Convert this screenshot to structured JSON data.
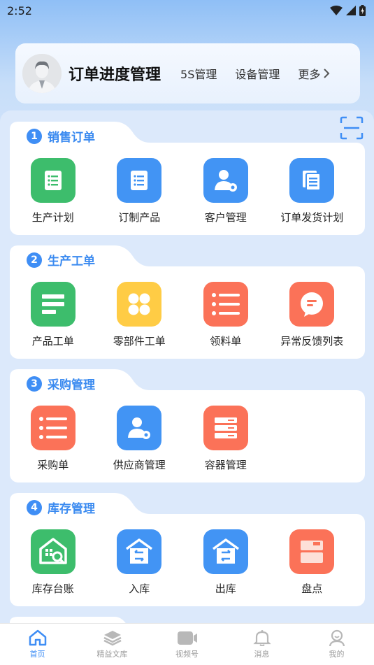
{
  "status": {
    "time": "2:52"
  },
  "header": {
    "title": "订单进度管理",
    "links": [
      "5S管理",
      "设备管理"
    ],
    "more_label": "更多"
  },
  "sections": [
    {
      "number": "1",
      "title": "销售订单",
      "items": [
        {
          "label": "生产计划",
          "icon": "list-doc-icon",
          "color": "#3dbd6c"
        },
        {
          "label": "订制产品",
          "icon": "list-doc-icon",
          "color": "#4294f4"
        },
        {
          "label": "客户管理",
          "icon": "user-gear-icon",
          "color": "#4294f4"
        },
        {
          "label": "订单发货计划",
          "icon": "documents-icon",
          "color": "#4294f4"
        }
      ]
    },
    {
      "number": "2",
      "title": "生产工单",
      "items": [
        {
          "label": "产品工单",
          "icon": "lines-icon",
          "color": "#3dbd6c"
        },
        {
          "label": "零部件工单",
          "icon": "four-dots-icon",
          "color": "#ffcc45"
        },
        {
          "label": "领料单",
          "icon": "bullet-list-icon",
          "color": "#fb7258"
        },
        {
          "label": "异常反馈列表",
          "icon": "chat-bubble-icon",
          "color": "#fb7258"
        }
      ]
    },
    {
      "number": "3",
      "title": "采购管理",
      "items": [
        {
          "label": "采购单",
          "icon": "bullet-list-icon",
          "color": "#fb7258"
        },
        {
          "label": "供应商管理",
          "icon": "user-gear-icon",
          "color": "#4294f4"
        },
        {
          "label": "容器管理",
          "icon": "server-icon",
          "color": "#fb7258"
        }
      ]
    },
    {
      "number": "4",
      "title": "库存管理",
      "items": [
        {
          "label": "库存台账",
          "icon": "warehouse-search-icon",
          "color": "#3dbd6c"
        },
        {
          "label": "入库",
          "icon": "warehouse-in-icon",
          "color": "#4294f4"
        },
        {
          "label": "出库",
          "icon": "warehouse-out-icon",
          "color": "#4294f4"
        },
        {
          "label": "盘点",
          "icon": "box-icon",
          "color": "#fb7258"
        }
      ]
    }
  ],
  "bottom_nav": [
    {
      "label": "首页",
      "icon": "home-icon",
      "active": true
    },
    {
      "label": "精益文库",
      "icon": "layers-icon",
      "active": false
    },
    {
      "label": "视频号",
      "icon": "video-icon",
      "active": false
    },
    {
      "label": "消息",
      "icon": "bell-icon",
      "active": false
    },
    {
      "label": "我的",
      "icon": "profile-icon",
      "active": false
    }
  ],
  "colors": {
    "accent": "#3f8ef5",
    "green": "#3dbd6c",
    "blue": "#4294f4",
    "yellow": "#ffcc45",
    "orange": "#fb7258"
  }
}
